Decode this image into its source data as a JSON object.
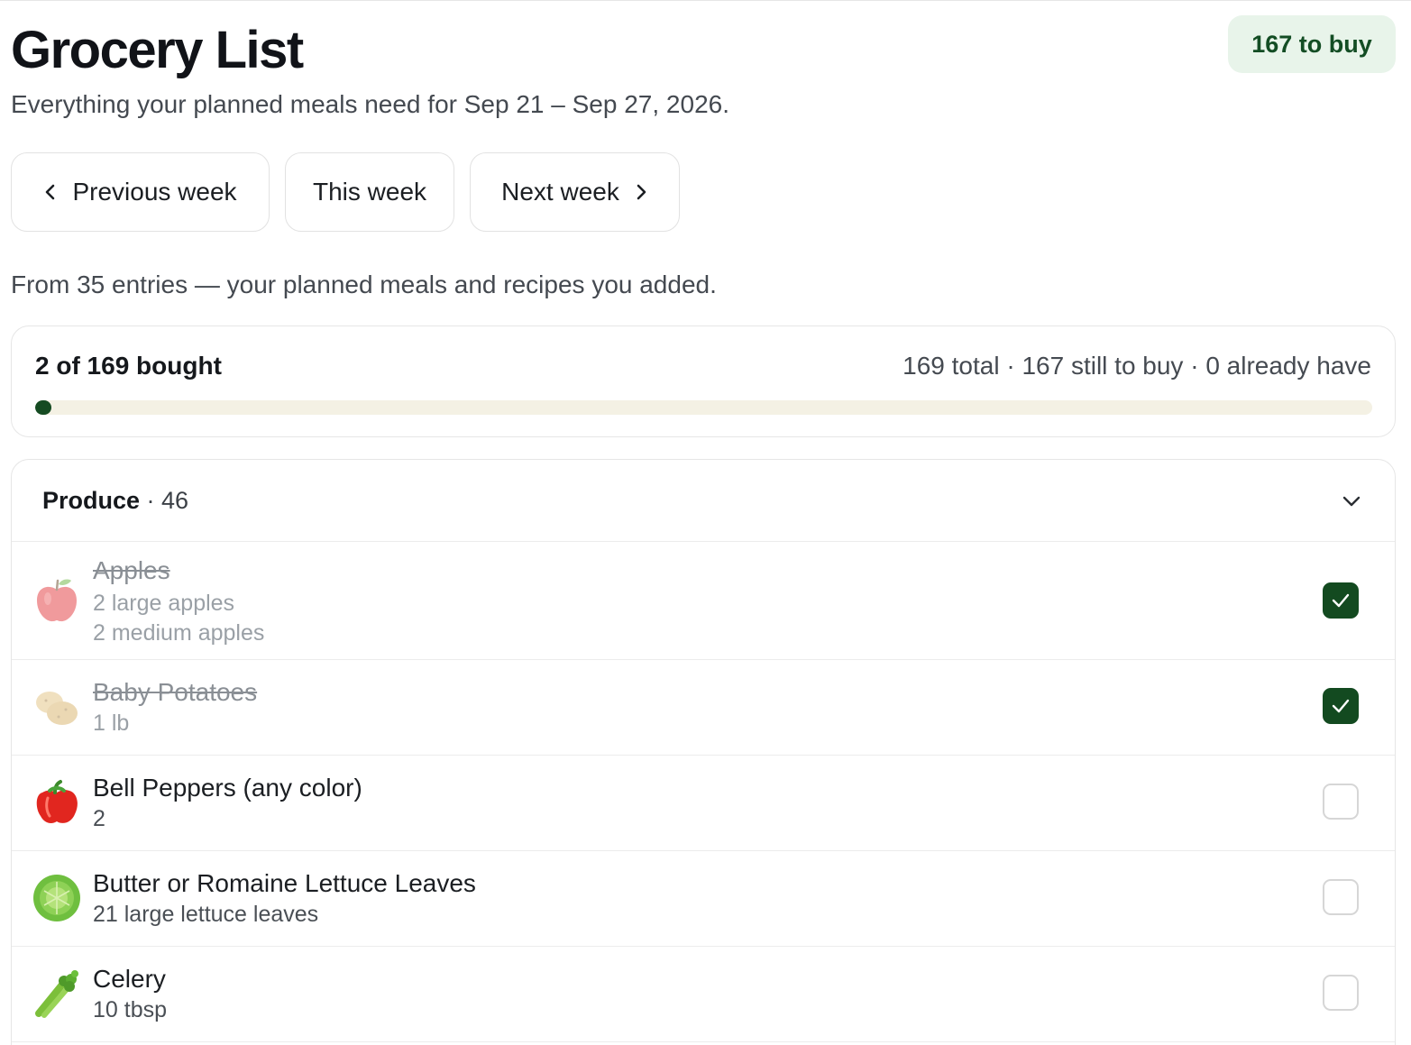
{
  "header": {
    "title": "Grocery List",
    "badge": "167 to buy",
    "subtitle": "Everything your planned meals need for Sep 21 – Sep 27, 2026."
  },
  "week_nav": {
    "previous": "Previous week",
    "current": "This week",
    "next": "Next week"
  },
  "source_note": "From 35 entries — your planned meals and recipes you added.",
  "progress": {
    "label": "2 of 169 bought",
    "stats": "169 total · 167 still to buy · 0 already have",
    "bought": 2,
    "total": 169
  },
  "category": {
    "name": "Produce",
    "count": "· 46",
    "items": [
      {
        "name": "Apples",
        "quantities": [
          "2 large apples",
          "2 medium apples"
        ],
        "checked": true,
        "icon": "apple-icon"
      },
      {
        "name": "Baby Potatoes",
        "quantities": [
          "1 lb"
        ],
        "checked": true,
        "icon": "potato-icon"
      },
      {
        "name": "Bell Peppers (any color)",
        "quantities": [
          "2"
        ],
        "checked": false,
        "icon": "bell-pepper-icon"
      },
      {
        "name": "Butter or Romaine Lettuce Leaves",
        "quantities": [
          "21 large lettuce leaves"
        ],
        "checked": false,
        "icon": "lettuce-icon"
      },
      {
        "name": "Celery",
        "quantities": [
          "10 tbsp"
        ],
        "checked": false,
        "icon": "celery-icon"
      }
    ]
  },
  "colors": {
    "accent": "#134a20",
    "badge_bg": "#e8f4ea",
    "badge_text": "#134d24",
    "track": "#f4f1e4"
  }
}
